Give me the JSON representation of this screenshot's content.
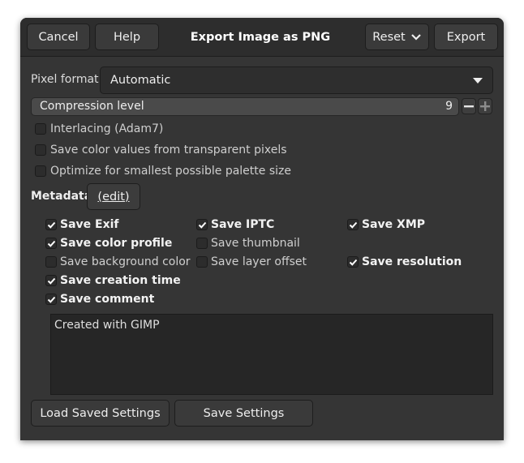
{
  "header": {
    "title": "Export Image as PNG",
    "cancel_label": "Cancel",
    "help_label": "Help",
    "reset_label": "Reset",
    "export_label": "Export"
  },
  "pixel_format": {
    "label": "Pixel format",
    "value": "Automatic"
  },
  "compression": {
    "label": "Compression level",
    "value": "9"
  },
  "options": {
    "interlacing": {
      "label": "Interlacing (Adam7)",
      "checked": false
    },
    "save_transparent": {
      "label": "Save color values from transparent pixels",
      "checked": false
    },
    "optimize_palette": {
      "label": "Optimize for smallest possible palette size",
      "checked": false
    }
  },
  "metadata": {
    "label": "Metadata",
    "edit_label": "(edit)",
    "save_exif": {
      "label": "Save Exif",
      "checked": true
    },
    "save_iptc": {
      "label": "Save IPTC",
      "checked": true
    },
    "save_xmp": {
      "label": "Save XMP",
      "checked": true
    },
    "save_color_profile": {
      "label": "Save color profile",
      "checked": true
    },
    "save_thumbnail": {
      "label": "Save thumbnail",
      "checked": false
    },
    "save_background_color": {
      "label": "Save background color",
      "checked": false
    },
    "save_layer_offset": {
      "label": "Save layer offset",
      "checked": false
    },
    "save_resolution": {
      "label": "Save resolution",
      "checked": true
    },
    "save_creation_time": {
      "label": "Save creation time",
      "checked": true
    },
    "save_comment": {
      "label": "Save comment",
      "checked": true
    },
    "comment_text": "Created with GIMP"
  },
  "footer": {
    "load_label": "Load Saved Settings",
    "save_label": "Save Settings"
  }
}
